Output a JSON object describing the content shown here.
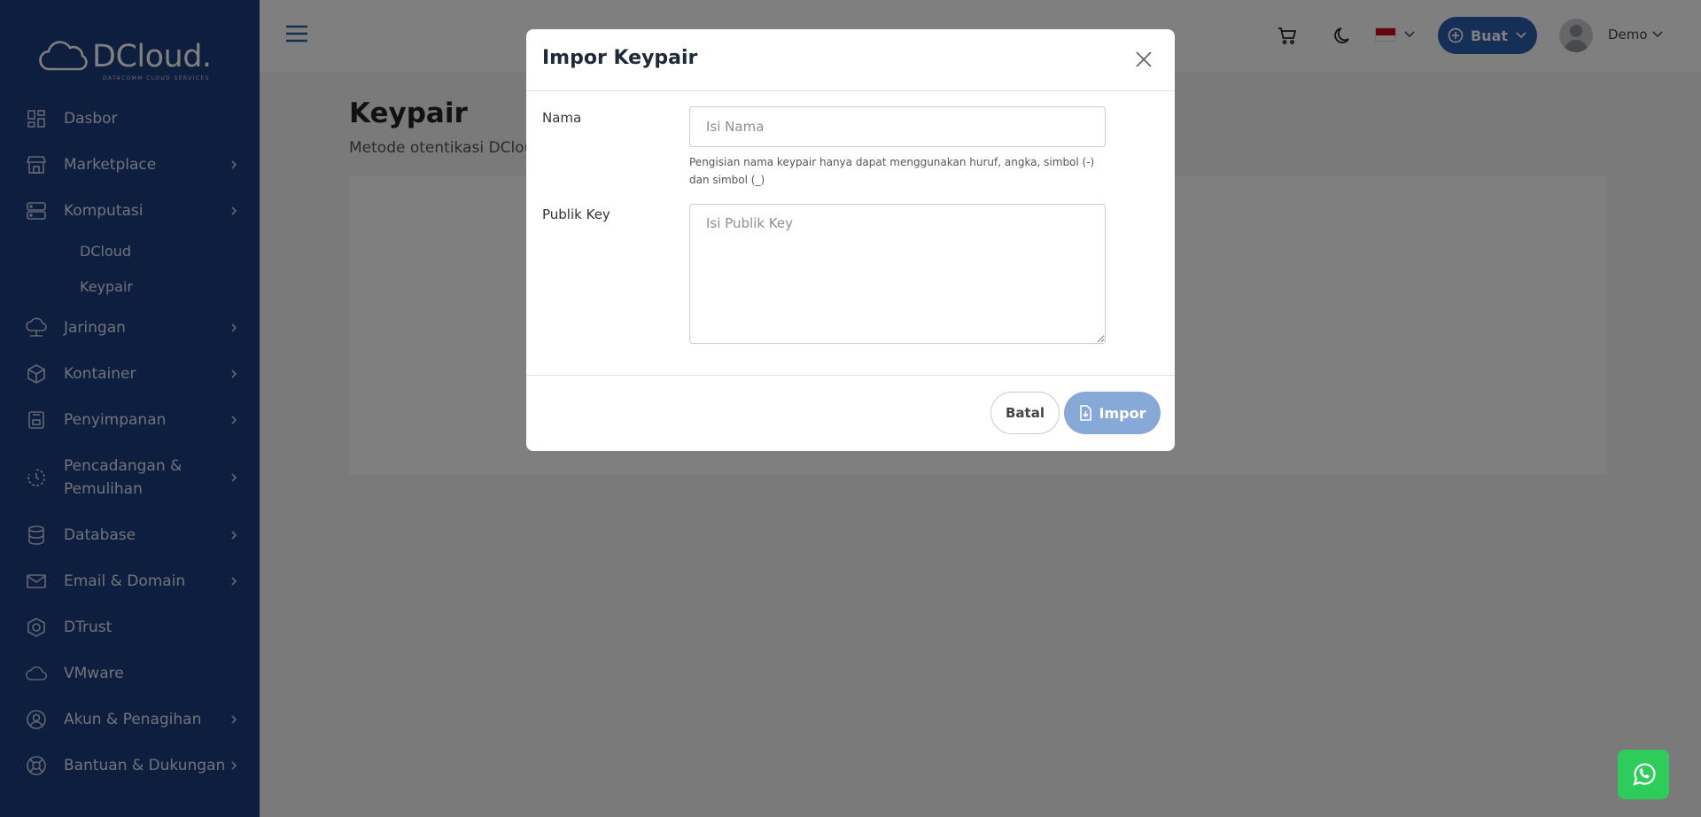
{
  "brand": {
    "name": "DCloud.",
    "tagline": "DATACOMM CLOUD SERVICES"
  },
  "sidebar": {
    "items": [
      {
        "label": "Dasbor",
        "icon": "dashboard-icon",
        "has_children": false
      },
      {
        "label": "Marketplace",
        "icon": "store-icon",
        "has_children": true
      },
      {
        "label": "Komputasi",
        "icon": "server-icon",
        "has_children": true,
        "children": [
          {
            "label": "DCloud"
          },
          {
            "label": "Keypair"
          }
        ]
      },
      {
        "label": "Jaringan",
        "icon": "cloud-network-icon",
        "has_children": true
      },
      {
        "label": "Kontainer",
        "icon": "box-icon",
        "has_children": true
      },
      {
        "label": "Penyimpanan",
        "icon": "storage-icon",
        "has_children": true
      },
      {
        "label_line1": "Pencadangan &",
        "label_line2": "Pemulihan",
        "icon": "backup-icon",
        "has_children": true
      },
      {
        "label": "Database",
        "icon": "database-icon",
        "has_children": true
      },
      {
        "label": "Email & Domain",
        "icon": "mail-icon",
        "has_children": true
      },
      {
        "label": "DTrust",
        "icon": "shield-hex-icon",
        "has_children": false
      },
      {
        "label": "VMware",
        "icon": "cloud-icon",
        "has_children": false
      },
      {
        "label": "Akun & Penagihan",
        "icon": "user-circle-icon",
        "has_children": true
      },
      {
        "label": "Bantuan & Dukungan",
        "icon": "lifebuoy-icon",
        "has_children": true
      }
    ]
  },
  "topbar": {
    "create_label": "Buat",
    "user_name": "Demo"
  },
  "page": {
    "title": "Keypair",
    "subtitle": "Metode otentikasi DClou"
  },
  "modal": {
    "title": "Impor Keypair",
    "name_label": "Nama",
    "name_placeholder": "Isi Nama",
    "name_value": "",
    "hint": "Pengisian nama keypair hanya dapat menggunakan huruf, angka, simbol (-) dan simbol (_)",
    "key_label": "Publik Key",
    "key_placeholder": "Isi Publik Key",
    "key_value": "",
    "cancel_label": "Batal",
    "import_label": "Impor"
  },
  "colors": {
    "sidebar_bg": "#1c3d7c",
    "primary": "#2d5eae",
    "import_disabled": "#86a9d8",
    "whatsapp": "#2ecc5a"
  }
}
